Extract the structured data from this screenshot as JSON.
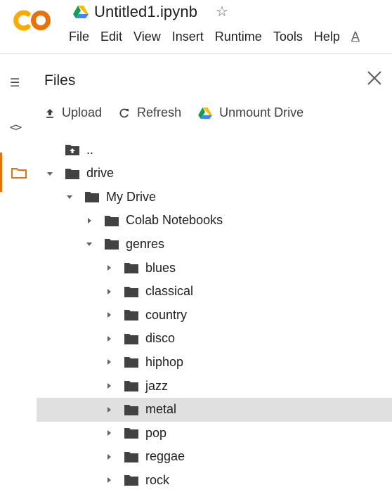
{
  "header": {
    "logo": "CO",
    "doc_title": "Untitled1.ipynb",
    "star_icon": "☆",
    "menu": [
      "File",
      "Edit",
      "View",
      "Insert",
      "Runtime",
      "Tools",
      "Help"
    ],
    "menu_overflow": "A"
  },
  "rail": {
    "toc_icon": "☰",
    "code_icon": "<>",
    "accent_color": "#e8710a"
  },
  "panel": {
    "title": "Files",
    "actions": {
      "upload": "Upload",
      "refresh": "Refresh",
      "unmount": "Unmount Drive"
    }
  },
  "tree": [
    {
      "label": "..",
      "depth": 0,
      "kind": "parent"
    },
    {
      "label": "drive",
      "depth": 0,
      "kind": "folder",
      "expanded": true
    },
    {
      "label": "My Drive",
      "depth": 1,
      "kind": "folder",
      "expanded": true
    },
    {
      "label": "Colab Notebooks",
      "depth": 2,
      "kind": "folder",
      "expanded": false
    },
    {
      "label": "genres",
      "depth": 2,
      "kind": "folder",
      "expanded": true
    },
    {
      "label": "blues",
      "depth": 3,
      "kind": "folder",
      "expanded": false
    },
    {
      "label": "classical",
      "depth": 3,
      "kind": "folder",
      "expanded": false
    },
    {
      "label": "country",
      "depth": 3,
      "kind": "folder",
      "expanded": false
    },
    {
      "label": "disco",
      "depth": 3,
      "kind": "folder",
      "expanded": false
    },
    {
      "label": "hiphop",
      "depth": 3,
      "kind": "folder",
      "expanded": false
    },
    {
      "label": "jazz",
      "depth": 3,
      "kind": "folder",
      "expanded": false
    },
    {
      "label": "metal",
      "depth": 3,
      "kind": "folder",
      "expanded": false,
      "selected": true
    },
    {
      "label": "pop",
      "depth": 3,
      "kind": "folder",
      "expanded": false
    },
    {
      "label": "reggae",
      "depth": 3,
      "kind": "folder",
      "expanded": false
    },
    {
      "label": "rock",
      "depth": 3,
      "kind": "folder",
      "expanded": false
    }
  ]
}
